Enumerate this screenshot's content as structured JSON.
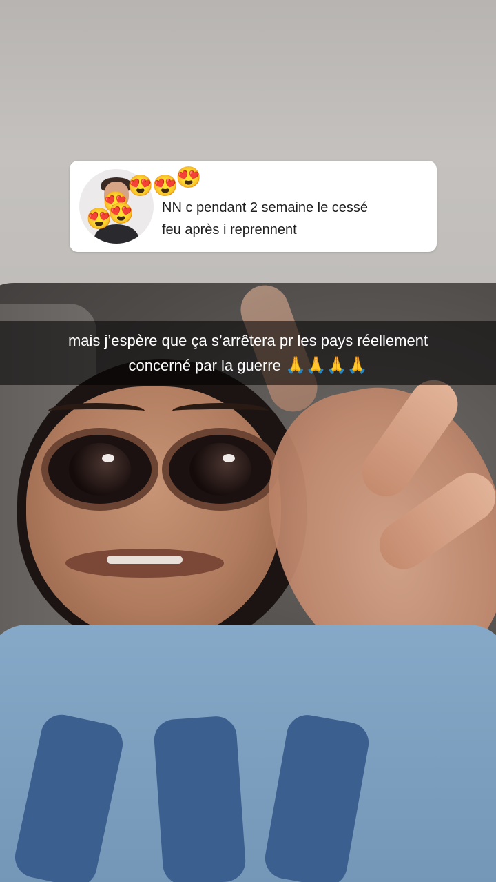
{
  "reply": {
    "text_line1": "NN c pendant 2 semaine le cessé",
    "text_line2": "feu après i reprennent",
    "decoration_emojis": [
      "😍",
      "😍",
      "😍",
      "😍",
      "😍",
      "😍"
    ],
    "avatar_icon": "bitmoji-avatar-icon"
  },
  "caption": {
    "line1": "mais j’espère que ça s’arrêtera pr les pays réellement",
    "line2": "concerné par la guerre",
    "emojis": "🙏🙏🙏🙏"
  },
  "colors": {
    "caption_bg": "rgba(0,0,0,0.55)",
    "reply_card_bg": "#ffffff",
    "reply_text": "#1e1e1e"
  }
}
